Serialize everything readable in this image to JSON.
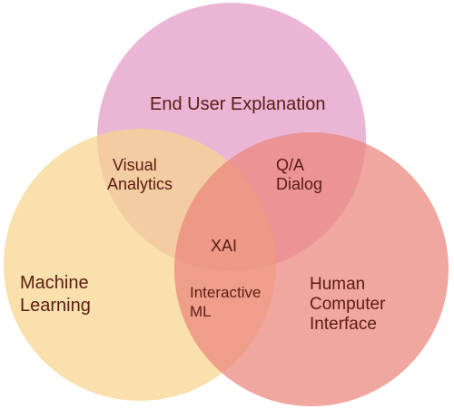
{
  "diagram": {
    "type": "venn",
    "sets": [
      {
        "id": "top",
        "label_lines": [
          "End User Explanation"
        ],
        "color": "#e39ac6"
      },
      {
        "id": "left",
        "label_lines": [
          "Machine",
          "Learning"
        ],
        "color": "#f7d48c"
      },
      {
        "id": "right",
        "label_lines": [
          "Human",
          "Computer",
          "Interface"
        ],
        "color": "#ea857c"
      }
    ],
    "intersections": {
      "top_left": [
        "Visual",
        "Analytics"
      ],
      "top_right": [
        "Q/A",
        "Dialog"
      ],
      "left_right": [
        "Interactive",
        "ML"
      ],
      "center": [
        "XAI"
      ]
    }
  }
}
